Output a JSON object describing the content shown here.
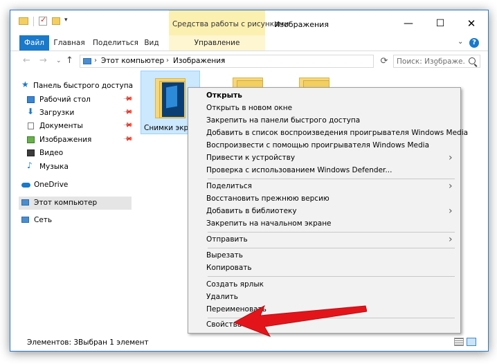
{
  "window": {
    "title": "Изображения",
    "contextual_tab_header": "Средства работы с рисунками",
    "controls": {
      "minimize": "—",
      "maximize": "☐",
      "close": "✕"
    }
  },
  "ribbon": {
    "tabs": [
      {
        "label": "Файл"
      },
      {
        "label": "Главная"
      },
      {
        "label": "Поделиться"
      },
      {
        "label": "Вид"
      },
      {
        "label": "Управление"
      }
    ],
    "help": "?",
    "collapse": "⌄"
  },
  "address": {
    "back": "←",
    "forward": "→",
    "recent": "⌄",
    "up": "↑",
    "path": [
      "Этот компьютер",
      "Изображения"
    ],
    "separator": "›",
    "refresh": "⟳"
  },
  "search": {
    "placeholder": "Поиск: Изображе..."
  },
  "nav": {
    "items": [
      {
        "label": "Панель быстрого доступа",
        "icon": "star-icon"
      },
      {
        "label": "Рабочий стол",
        "icon": "desktop-icon",
        "pinned": true
      },
      {
        "label": "Загрузки",
        "icon": "download-icon",
        "pinned": true
      },
      {
        "label": "Документы",
        "icon": "documents-icon",
        "pinned": true
      },
      {
        "label": "Изображения",
        "icon": "pictures-icon",
        "pinned": true
      },
      {
        "label": "Видео",
        "icon": "video-icon"
      },
      {
        "label": "Музыка",
        "icon": "music-icon"
      },
      {
        "label": "OneDrive",
        "icon": "cloud-icon"
      },
      {
        "label": "Этот компьютер",
        "icon": "computer-icon",
        "selected": true
      },
      {
        "label": "Сеть",
        "icon": "network-icon"
      }
    ],
    "pin_glyph": "📌"
  },
  "content": {
    "items": [
      {
        "label": "Снимки экрана",
        "selected": true
      }
    ]
  },
  "context_menu": {
    "groups": [
      [
        {
          "label": "Открыть",
          "bold": true
        },
        {
          "label": "Открыть в новом окне"
        },
        {
          "label": "Закрепить на панели быстрого доступа"
        },
        {
          "label": "Добавить в список воспроизведения проигрывателя Windows Media"
        },
        {
          "label": "Воспроизвести с помощью проигрывателя Windows Media"
        },
        {
          "label": "Привести к устройству",
          "submenu": true
        },
        {
          "label": "Проверка с использованием Windows Defender..."
        }
      ],
      [
        {
          "label": "Поделиться",
          "submenu": true
        },
        {
          "label": "Восстановить прежнюю версию"
        },
        {
          "label": "Добавить в библиотеку",
          "submenu": true
        },
        {
          "label": "Закрепить на начальном экране"
        }
      ],
      [
        {
          "label": "Отправить",
          "submenu": true
        }
      ],
      [
        {
          "label": "Вырезать"
        },
        {
          "label": "Копировать"
        }
      ],
      [
        {
          "label": "Создать ярлык"
        },
        {
          "label": "Удалить"
        },
        {
          "label": "Переименовать"
        }
      ],
      [
        {
          "label": "Свойства"
        }
      ]
    ],
    "submenu_glyph": "›"
  },
  "status": {
    "items_count": "Элементов: 3",
    "selected_count": "Выбран 1 элемент"
  },
  "colors": {
    "accent": "#1979ca",
    "contextual_tab": "#fbf0b0",
    "annotation_arrow": "#e3151b"
  }
}
